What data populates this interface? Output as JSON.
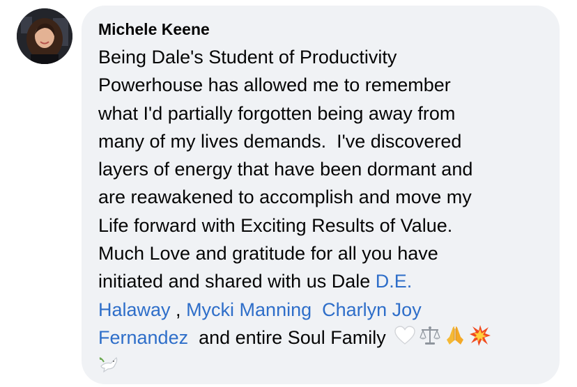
{
  "comment": {
    "author": "Michele Keene",
    "text": {
      "line1": "Being Dale's Student of Productivity",
      "line2": "Powerhouse has allowed me to remember",
      "line3": "what I'd partially forgotten being away from",
      "line4": "many of my lives demands.  I've discovered",
      "line5": "layers of energy that have been dormant and",
      "line6": "are reawakened to accomplish and move my",
      "line7": "Life forward with Exciting Results of Value.",
      "line8": "Much Love and gratitude for all you have",
      "line9": "initiated and shared with us Dale ",
      "line10_sep1": " , ",
      "line10_sep2": "  ",
      "line11_tail": "  and entire Soul Family "
    },
    "mentions": {
      "de_halaway_part1": "D.E.",
      "de_halaway_part2": "Halaway",
      "mycki_manning": "Mycki Manning",
      "charlyn_part1": "Charlyn Joy",
      "charlyn_part2": "Fernandez"
    },
    "emojis": [
      "white-heart-icon",
      "balance-scale-icon",
      "folded-hands-icon",
      "collision-icon",
      "dove-icon"
    ],
    "colors": {
      "bubble": "#f0f2f5",
      "mention": "#2e6ec9",
      "text": "#050505"
    }
  }
}
